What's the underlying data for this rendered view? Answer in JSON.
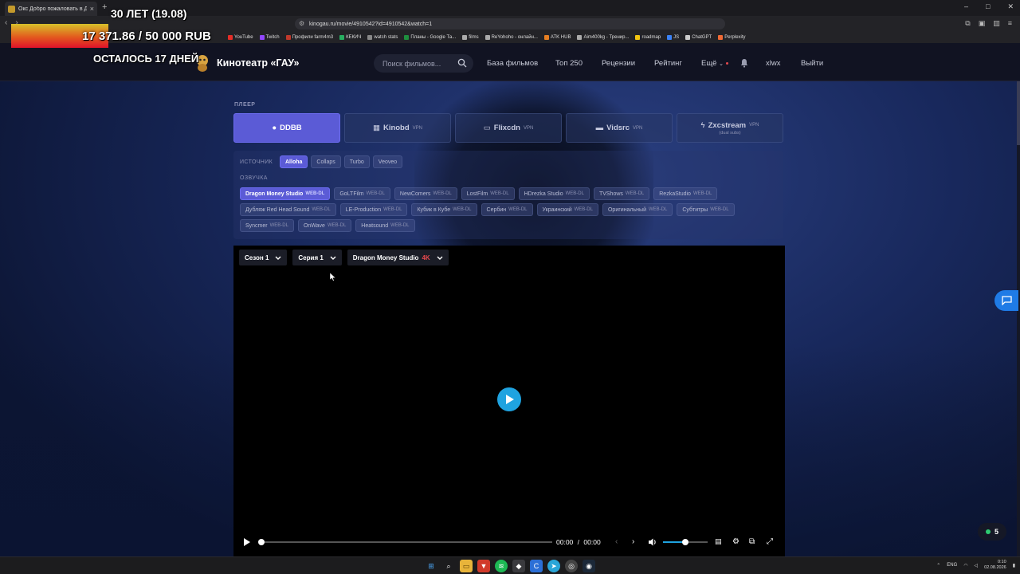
{
  "browser": {
    "tab_title": "Окс Добро пожаловать в Дер",
    "new_tab": "+",
    "url": "kinogau.ru/movie/4910542?id=4910542&watch=1",
    "bookmarks": [
      {
        "label": "YouTube",
        "color": "#e52d27"
      },
      {
        "label": "Twitch",
        "color": "#9146ff"
      },
      {
        "label": "Профили farm4m3",
        "color": "#c0392b"
      },
      {
        "label": "КЕКИЧ",
        "color": "#27ae60"
      },
      {
        "label": "watch stats",
        "color": "#888888"
      },
      {
        "label": "Планы - Google Та...",
        "color": "#1e8e3e"
      },
      {
        "label": "films",
        "color": "#aaaaaa"
      },
      {
        "label": "ReYohoho - онлайн...",
        "color": "#aaaaaa"
      },
      {
        "label": "ATK HUB",
        "color": "#e67e22"
      },
      {
        "label": "Aim400kg - Тренир...",
        "color": "#aaaaaa"
      },
      {
        "label": "roadmap",
        "color": "#f1c40f"
      },
      {
        "label": "JS",
        "color": "#3b82f6"
      },
      {
        "label": "ChatGPT",
        "color": "#cccccc"
      },
      {
        "label": "Perplexity",
        "color": "#f06a35"
      }
    ]
  },
  "overlay": {
    "age": "30 ЛЕТ (19.08)",
    "amount": "17 371.86 / 50 000 RUB",
    "progress": 0.347,
    "remaining": "ОСТАЛОСЬ 17 ДНЕЙ"
  },
  "site": {
    "logo": "Кинотеатр «ГАУ»",
    "search_placeholder": "Поиск фильмов...",
    "nav": [
      "База фильмов",
      "Топ 250",
      "Рецензии",
      "Рейтинг",
      "Ещё"
    ],
    "user": "xlwx",
    "logout": "Выйти"
  },
  "player": {
    "label": "ПЛЕЕР",
    "players": [
      {
        "name": "DDBB",
        "icon": "play-circle-icon",
        "vpn": "",
        "sub": "",
        "active": true
      },
      {
        "name": "Kinobd",
        "icon": "film-icon",
        "vpn": "VPN",
        "sub": "",
        "active": false
      },
      {
        "name": "Flixcdn",
        "icon": "monitor-icon",
        "vpn": "VPN",
        "sub": "",
        "active": false
      },
      {
        "name": "Vidsrc",
        "icon": "clapper-icon",
        "vpn": "VPN",
        "sub": "",
        "active": false
      },
      {
        "name": "Zxcstream",
        "icon": "bolt-icon",
        "vpn": "VPN",
        "sub": "(dual subs)",
        "active": false
      }
    ],
    "source_label": "ИСТОЧНИК",
    "sources": [
      {
        "name": "Alloha",
        "active": true
      },
      {
        "name": "Collaps",
        "active": false
      },
      {
        "name": "Turbo",
        "active": false
      },
      {
        "name": "Veoveo",
        "active": false
      }
    ],
    "voice_label": "ОЗВУЧКА",
    "voices": [
      {
        "name": "Dragon Money Studio",
        "tag": "WEB-DL",
        "active": true
      },
      {
        "name": "GoLTFilm",
        "tag": "WEB-DL",
        "active": false
      },
      {
        "name": "NewComers",
        "tag": "WEB-DL",
        "active": false
      },
      {
        "name": "LostFilm",
        "tag": "WEB-DL",
        "active": false
      },
      {
        "name": "HDrezka Studio",
        "tag": "WEB-DL",
        "active": false
      },
      {
        "name": "TVShows",
        "tag": "WEB-DL",
        "active": false
      },
      {
        "name": "RezkaStudio",
        "tag": "WEB-DL",
        "active": false
      },
      {
        "name": "Дубляж Red Head Sound",
        "tag": "WEB-DL",
        "active": false
      },
      {
        "name": "LE-Production",
        "tag": "WEB-DL",
        "active": false
      },
      {
        "name": "Кубик в Кубе",
        "tag": "WEB-DL",
        "active": false
      },
      {
        "name": "Сербин",
        "tag": "WEB-DL",
        "active": false
      },
      {
        "name": "Украинский",
        "tag": "WEB-DL",
        "active": false
      },
      {
        "name": "Оригинальный",
        "tag": "WEB-DL",
        "active": false
      },
      {
        "name": "Субтитры",
        "tag": "WEB-DL",
        "active": false
      },
      {
        "name": "Syncmer",
        "tag": "WEB-DL",
        "active": false
      },
      {
        "name": "OnWave",
        "tag": "WEB-DL",
        "active": false
      },
      {
        "name": "Heatsound",
        "tag": "WEB-DL",
        "active": false
      }
    ],
    "season": "Сезон 1",
    "episode": "Серия 1",
    "voice_select": "Dragon Money Studio",
    "quality": "4K",
    "time_current": "00:00",
    "time_sep": "/",
    "time_total": "00:00",
    "volume": 0.5
  },
  "widgets": {
    "online_count": "5"
  },
  "taskbar": {
    "lang": "ENG",
    "time": "0:10",
    "date": "02.08.2026"
  },
  "colors": {
    "accent": "#5b5bd6",
    "play": "#1fa3e0",
    "quality": "#e5484d"
  }
}
